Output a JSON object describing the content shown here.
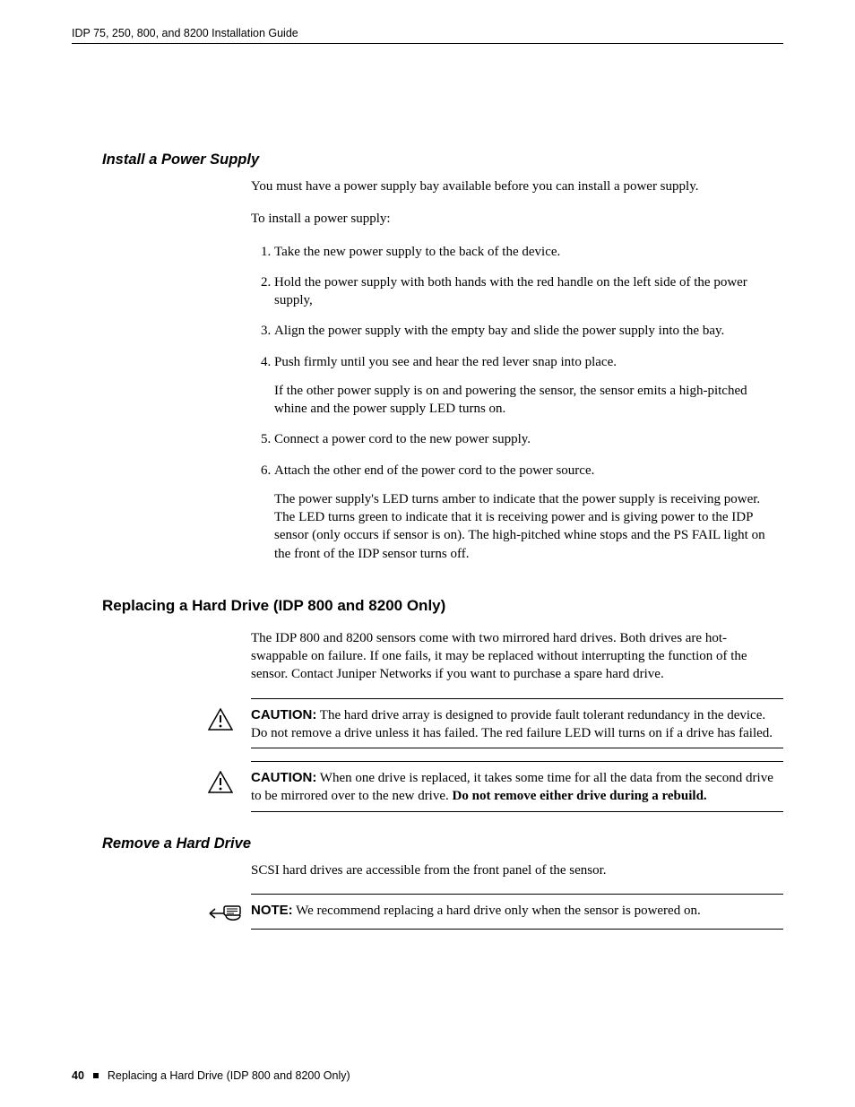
{
  "header": {
    "running": "IDP 75, 250, 800, and 8200 Installation Guide"
  },
  "section_install_ps": {
    "heading": "Install a Power Supply",
    "intro1": "You must have a power supply bay available before you can install a power supply.",
    "intro2": "To install a power supply:",
    "steps": {
      "s1": "Take the new power supply to the back of the device.",
      "s2": "Hold the power supply with both hands with the red handle on the left side of the power supply,",
      "s3": "Align the power supply with the empty bay and slide the power supply into the bay.",
      "s4": "Push firmly until you see and hear the red lever snap into place.",
      "s4_extra": "If the other power supply is on and powering the sensor, the sensor emits a high-pitched whine and the power supply LED turns on.",
      "s5": "Connect a power cord to the new power supply.",
      "s6": "Attach the other end of the power cord to the power source.",
      "s6_extra": "The power supply's LED turns amber to indicate that the power supply is receiving power. The LED turns green to indicate that it is receiving power and is giving power to the IDP sensor (only occurs if sensor is on). The high-pitched whine stops and the PS FAIL light on the front of the IDP sensor turns off."
    }
  },
  "section_replace_hd": {
    "heading": "Replacing a Hard Drive (IDP 800 and 8200 Only)",
    "para": "The IDP 800 and 8200 sensors come with two mirrored hard drives. Both drives are hot-swappable on failure. If one fails, it may be replaced without interrupting the function of the sensor. Contact Juniper Networks if you want to purchase a spare hard drive.",
    "caution1": {
      "label": "CAUTION:",
      "text": " The hard drive array is designed to provide fault tolerant redundancy in the device. Do not remove a drive unless it has failed. The red failure LED will turns on if a drive has failed."
    },
    "caution2": {
      "label": "CAUTION:",
      "text_a": " When one drive is replaced, it takes some time for all the data from the second drive to be mirrored over to the new drive. ",
      "bold": "Do not remove either drive during a rebuild."
    }
  },
  "section_remove_hd": {
    "heading": "Remove a Hard Drive",
    "para": "SCSI hard drives are accessible from the front panel of the sensor.",
    "note": {
      "label": "NOTE:",
      "text": " We recommend replacing a hard drive only when the sensor is powered on."
    }
  },
  "footer": {
    "page_number": "40",
    "section": "Replacing a Hard Drive (IDP 800 and 8200 Only)"
  }
}
